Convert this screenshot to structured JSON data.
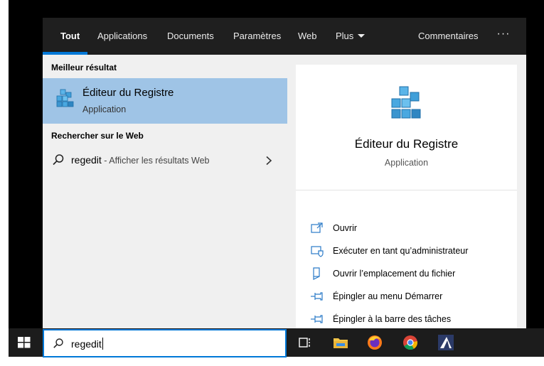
{
  "tabs": [
    {
      "label": "Tout",
      "active": true
    },
    {
      "label": "Applications"
    },
    {
      "label": "Documents"
    },
    {
      "label": "Paramètres"
    },
    {
      "label": "Web"
    },
    {
      "label": "Plus"
    }
  ],
  "header": {
    "feedback": "Commentaires",
    "more": "···"
  },
  "left": {
    "best_heading": "Meilleur résultat",
    "best": {
      "title": "Éditeur du Registre",
      "subtitle": "Application",
      "icon": "registry-editor-icon"
    },
    "web_heading": "Rechercher sur le Web",
    "web": {
      "query": "regedit",
      "hint": " - Afficher les résultats Web"
    }
  },
  "preview": {
    "title": "Éditeur du Registre",
    "subtitle": "Application",
    "actions": [
      {
        "label": "Ouvrir",
        "icon": "open-icon"
      },
      {
        "label": "Exécuter en tant qu’administrateur",
        "icon": "admin-shield-icon"
      },
      {
        "label": "Ouvrir l’emplacement du fichier",
        "icon": "file-location-icon"
      },
      {
        "label": "Épingler au menu Démarrer",
        "icon": "pin-icon"
      },
      {
        "label": "Épingler à la barre des tâches",
        "icon": "pin-icon"
      }
    ]
  },
  "taskbar": {
    "search_value": "regedit",
    "apps": [
      "task-view-icon",
      "file-explorer-icon",
      "firefox-icon",
      "chrome-icon",
      "app-icon"
    ]
  },
  "colors": {
    "accent": "#0078d7",
    "selected_bg": "#9fc4e6",
    "header_bg": "#1f1f1f",
    "taskbar_bg": "#1c1c1c"
  }
}
